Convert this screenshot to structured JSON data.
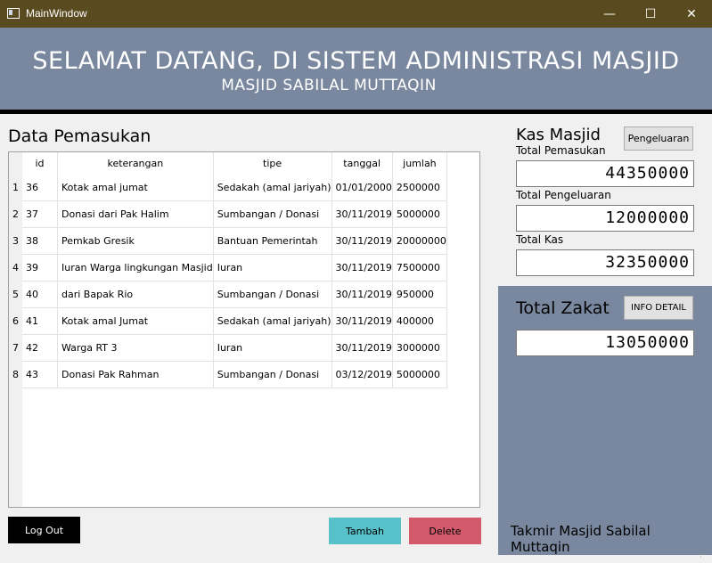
{
  "window": {
    "title": "MainWindow",
    "controls": {
      "minimize": "—",
      "maximize": "☐",
      "close": "✕"
    }
  },
  "header": {
    "title": "SELAMAT DATANG, DI SISTEM ADMINISTRASI MASJID",
    "subtitle": "MASJID SABILAL MUTTAQIN"
  },
  "main": {
    "section_title": "Data Pemasukan",
    "table": {
      "columns": [
        "id",
        "keterangan",
        "tipe",
        "tanggal",
        "jumlah"
      ],
      "rows": [
        {
          "n": "1",
          "id": "36",
          "keterangan": "Kotak amal jumat",
          "tipe": "Sedakah (amal jariyah)",
          "tanggal": "01/01/2000",
          "jumlah": "2500000"
        },
        {
          "n": "2",
          "id": "37",
          "keterangan": "Donasi dari Pak Halim",
          "tipe": "Sumbangan / Donasi",
          "tanggal": "30/11/2019",
          "jumlah": "5000000"
        },
        {
          "n": "3",
          "id": "38",
          "keterangan": "Pemkab Gresik",
          "tipe": "Bantuan Pemerintah",
          "tanggal": "30/11/2019",
          "jumlah": "20000000"
        },
        {
          "n": "4",
          "id": "39",
          "keterangan": "Iuran Warga lingkungan Masjid",
          "tipe": "Iuran",
          "tanggal": "30/11/2019",
          "jumlah": "7500000"
        },
        {
          "n": "5",
          "id": "40",
          "keterangan": "dari Bapak Rio",
          "tipe": "Sumbangan / Donasi",
          "tanggal": "30/11/2019",
          "jumlah": "950000"
        },
        {
          "n": "6",
          "id": "41",
          "keterangan": "Kotak amal Jumat",
          "tipe": "Sedakah (amal jariyah)",
          "tanggal": "30/11/2019",
          "jumlah": "400000"
        },
        {
          "n": "7",
          "id": "42",
          "keterangan": "Warga RT 3",
          "tipe": "Iuran",
          "tanggal": "30/11/2019",
          "jumlah": "3000000"
        },
        {
          "n": "8",
          "id": "43",
          "keterangan": "Donasi Pak Rahman",
          "tipe": "Sumbangan / Donasi",
          "tanggal": "03/12/2019",
          "jumlah": "5000000"
        }
      ]
    },
    "buttons": {
      "logout": "Log Out",
      "tambah": "Tambah",
      "delete": "Delete"
    }
  },
  "kas": {
    "title": "Kas Masjid",
    "pengeluaran_button": "Pengeluaran",
    "total_pemasukan_label": "Total Pemasukan",
    "total_pemasukan": "44350000",
    "total_pengeluaran_label": "Total Pengeluaran",
    "total_pengeluaran": "12000000",
    "total_kas_label": "Total Kas",
    "total_kas": "32350000"
  },
  "zakat": {
    "title": "Total Zakat",
    "info_button": "INFO DETAIL",
    "total": "13050000",
    "footer": "Takmir Masjid Sabilal Muttaqin"
  },
  "colors": {
    "titlebar": "#5a4a1f",
    "header": "#7a889f",
    "tambah": "#57c0c8",
    "delete": "#d25a6b",
    "logout": "#000000"
  }
}
